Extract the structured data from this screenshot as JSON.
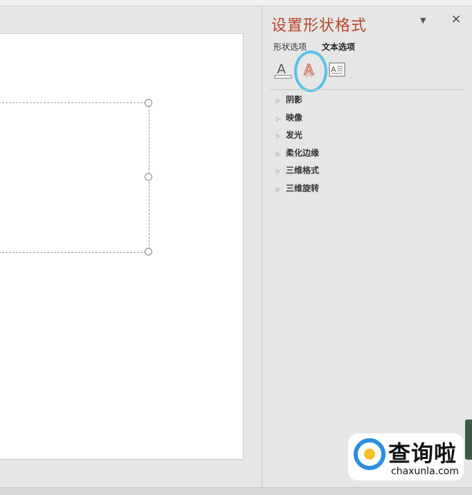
{
  "panel": {
    "title": "设置形状格式",
    "menu_icon": "dropdown-arrow-icon",
    "close_label": "×",
    "tabs": [
      {
        "label": "形状选项",
        "active": false
      },
      {
        "label": "文本选项",
        "active": true
      }
    ],
    "icons": [
      "text-fill-outline-icon",
      "text-effects-icon",
      "textbox-icon"
    ],
    "sections": [
      {
        "label": "阴影"
      },
      {
        "label": "映像"
      },
      {
        "label": "发光"
      },
      {
        "label": "柔化边缘"
      },
      {
        "label": "三维格式"
      },
      {
        "label": "三维旋转"
      }
    ]
  },
  "watermark": {
    "cn": "查询啦",
    "en": "chaxunla.com"
  },
  "colors": {
    "accent": "#b7472a",
    "highlight": "#59c3ea"
  }
}
